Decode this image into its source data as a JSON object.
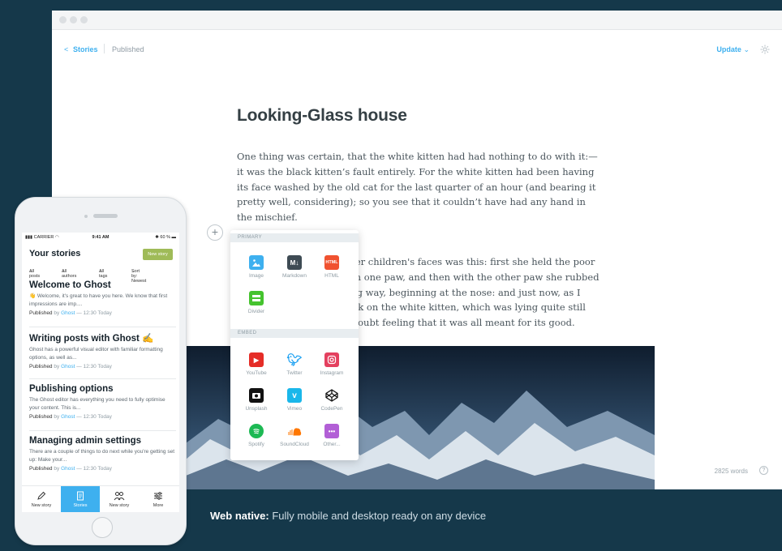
{
  "editor": {
    "breadcrumb_back": "<",
    "breadcrumb_stories": "Stories",
    "status": "Published",
    "update_label": "Update",
    "post_title": "Looking-Glass house",
    "paragraph1": "One thing was certain, that the white kitten had had nothing to do with it:— it was the black kitten’s fault entirely. For the white kitten had been having its face washed by the old cat for the last quarter of an hour (and bearing it pretty well, considering); so you see that it couldn’t have had any hand in the mischief.",
    "paragraph2": "The way Dinah washed her children's faces was this: first she held the poor thing down by its ear with one paw, and then with the other paw she rubbed its face all over, the wrong way, beginning at the nose: and just now, as I said, she was hard at work on the white kitten, which was lying quite still and trying to purr — no doubt feeling that it was all meant for its good.",
    "word_count": "2825 words",
    "help": "?"
  },
  "card_menu": {
    "primary_label": "PRIMARY",
    "embed_label": "EMBED",
    "primary": [
      {
        "label": "Image",
        "icon": "image-icon",
        "color": "#3eb0ef"
      },
      {
        "label": "Markdown",
        "icon": "markdown-icon",
        "color": "#3e4b54"
      },
      {
        "label": "HTML",
        "icon": "html-icon",
        "color": "#f05230"
      },
      {
        "label": "Divider",
        "icon": "divider-icon",
        "color": "#45c32e"
      }
    ],
    "embed": [
      {
        "label": "YouTube",
        "icon": "youtube-icon",
        "color": "#e52d27"
      },
      {
        "label": "Twitter",
        "icon": "twitter-icon",
        "color": "#1da1f2"
      },
      {
        "label": "Instagram",
        "icon": "instagram-icon",
        "color": "#e4405f"
      },
      {
        "label": "Unsplash",
        "icon": "unsplash-icon",
        "color": "#111111"
      },
      {
        "label": "Vimeo",
        "icon": "vimeo-icon",
        "color": "#1ab7ea"
      },
      {
        "label": "CodePen",
        "icon": "codepen-icon",
        "color": "#111111"
      },
      {
        "label": "Spotify",
        "icon": "spotify-icon",
        "color": "#1db954"
      },
      {
        "label": "SoundCloud",
        "icon": "soundcloud-icon",
        "color": "#ff7700"
      },
      {
        "label": "Other...",
        "icon": "other-icon",
        "color": "#b25fd6"
      }
    ]
  },
  "caption": {
    "bold": "Web native:",
    "text": " Fully mobile and desktop ready on any device"
  },
  "phone": {
    "carrier": "CARRIER",
    "time": "9:41 AM",
    "battery": "60 %",
    "title": "Your stories",
    "new_story_button": "New story",
    "filters": [
      "All posts",
      "All authors",
      "All tags",
      "Sort by: Newest"
    ],
    "stories": [
      {
        "title": "Welcome to Ghost",
        "excerpt": "👋 Welcome, it's great to have you here. We know that first impressions are imp....",
        "status": "Published",
        "by": "by",
        "author": "Ghost",
        "time": "— 12:30 Today"
      },
      {
        "title": "Writing posts with Ghost ✍️",
        "excerpt": "Ghost has a powerful visual editor with familiar formatting options, as well as...",
        "status": "Published",
        "by": "by",
        "author": "Ghost",
        "time": "— 12:30 Today"
      },
      {
        "title": "Publishing options",
        "excerpt": "The Ghost editor has everything you need to fully optimise your content. This is...",
        "status": "Published",
        "by": "by",
        "author": "Ghost",
        "time": "— 12:30 Today"
      },
      {
        "title": "Managing admin settings",
        "excerpt": "There are a couple of things to do next while you're getting set up: Make your...",
        "status": "Published",
        "by": "by",
        "author": "Ghost",
        "time": "— 12:30 Today"
      }
    ],
    "tabs": [
      "New story",
      "Stories",
      "New story",
      "More"
    ]
  }
}
